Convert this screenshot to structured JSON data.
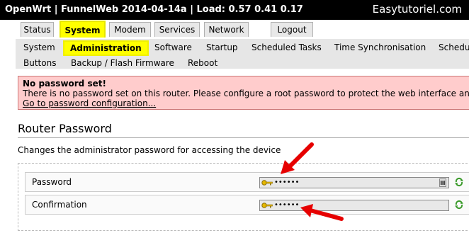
{
  "titlebar": {
    "title": "OpenWrt | FunnelWeb 2014-04-14a | Load: 0.57 0.41 0.17",
    "watermark": "Easytutoriel.com"
  },
  "tabs": [
    "Status",
    "System",
    "Modem",
    "Services",
    "Network",
    "Logout"
  ],
  "active_tab": "System",
  "subnav": {
    "row1": [
      "System",
      "Administration",
      "Software",
      "Startup",
      "Scheduled Tasks",
      "Time Synchronisation",
      "Schedule"
    ],
    "row2": [
      "Buttons",
      "Backup / Flash Firmware",
      "Reboot"
    ],
    "active": "Administration"
  },
  "alert": {
    "title": "No password set!",
    "message": "There is no password set on this router. Please configure a root password to protect the web interface and e",
    "link": "Go to password configuration..."
  },
  "section": {
    "title": "Router Password",
    "description": "Changes the administrator password for accessing the device"
  },
  "fields": {
    "password_label": "Password",
    "password_value": "••••••",
    "confirmation_label": "Confirmation",
    "confirmation_value": "••••••"
  },
  "colors": {
    "highlight": "#ffff00",
    "alert_bg": "#ffcccc",
    "arrow": "#e60000"
  },
  "icons": [
    "key-icon",
    "reveal-icon",
    "reset-icon"
  ]
}
